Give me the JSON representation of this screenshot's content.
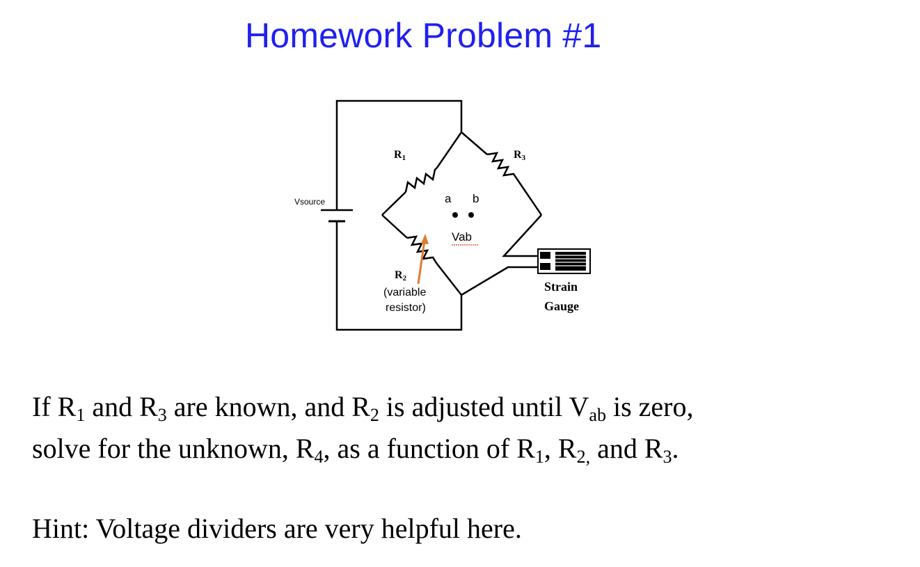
{
  "title": "Homework Problem #1",
  "diagram": {
    "vsource_label": "Vsource",
    "r1_label": "R",
    "r1_sub": "1",
    "r3_label": "R",
    "r3_sub": "3",
    "r2_label": "R",
    "r2_sub": "2",
    "r2_note_line1": "(variable",
    "r2_note_line2": "resistor)",
    "node_a": "a",
    "node_b": "b",
    "vab_label": "Vab",
    "gauge_label_line1": "Strain",
    "gauge_label_line2": "Gauge"
  },
  "problem": {
    "l1_a": "If R",
    "l1_s1": "1",
    "l1_b": " and R",
    "l1_s2": "3",
    "l1_c": " are known, and R",
    "l1_s3": "2",
    "l1_d": " is adjusted until V",
    "l1_s4": "ab",
    "l1_e": " is zero,",
    "l2_a": "solve for the unknown, R",
    "l2_s1": "4",
    "l2_b": ", as a function of R",
    "l2_s2": "1",
    "l2_c": ", R",
    "l2_s3": "2,",
    "l2_d": " and R",
    "l2_s4": "3",
    "l2_e": ".",
    "hint": "Hint:  Voltage dividers are very helpful here."
  },
  "colors": {
    "title": "#2020f0",
    "arrow": "#e07b30",
    "wire": "#000000"
  }
}
